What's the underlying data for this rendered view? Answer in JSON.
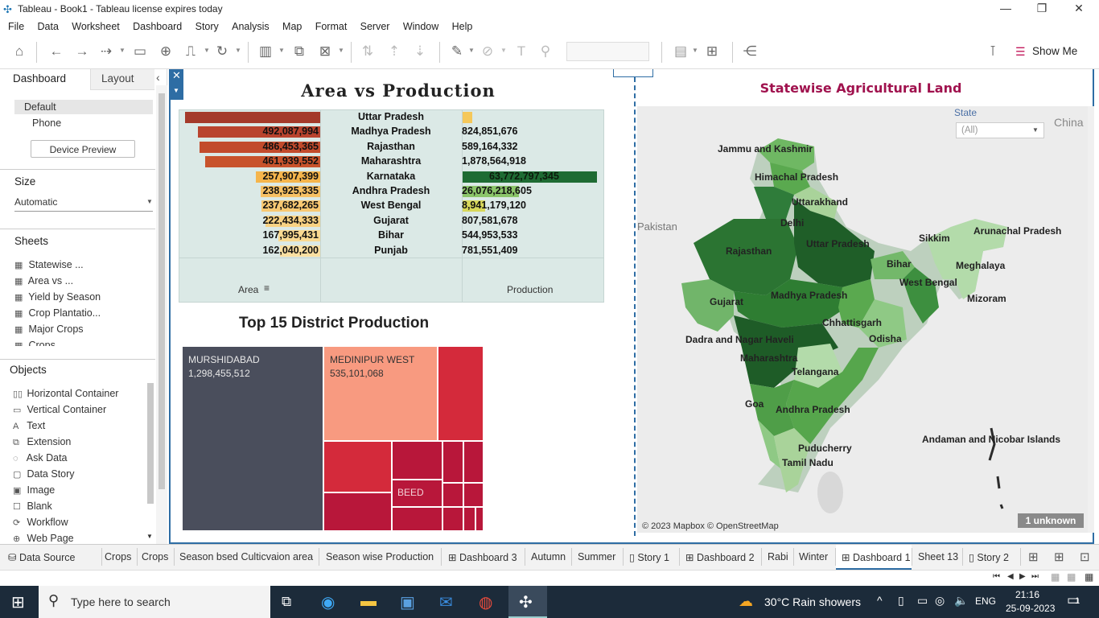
{
  "window": {
    "title": "Tableau - Book1 - Tableau license expires today"
  },
  "menu": [
    "File",
    "Data",
    "Worksheet",
    "Dashboard",
    "Story",
    "Analysis",
    "Map",
    "Format",
    "Server",
    "Window",
    "Help"
  ],
  "toolbar": {
    "show_me": "Show Me"
  },
  "left_panel": {
    "tab_dashboard": "Dashboard",
    "tab_layout": "Layout",
    "devices": [
      "Default",
      "Phone"
    ],
    "device_preview": "Device Preview",
    "size_heading": "Size",
    "size_value": "Automatic",
    "sheets_heading": "Sheets",
    "sheets": [
      "Statewise ...",
      "Area vs ...",
      "Yield by Season",
      "Crop Plantatio...",
      "Major Crops",
      "Crops"
    ],
    "objects_heading": "Objects",
    "objects": [
      "Horizontal Container",
      "Vertical Container",
      "Text",
      "Extension",
      "Ask Data",
      "Data Story",
      "Image",
      "Blank",
      "Workflow",
      "Web Page"
    ]
  },
  "area_vs_production": {
    "title": "Area vs Production",
    "area_header": "Area",
    "production_header": "Production",
    "rows": [
      {
        "state": "Uttar Pradesh",
        "area": "",
        "production": ""
      },
      {
        "state": "Madhya Pradesh",
        "area": "492,087,994",
        "production": "824,851,676"
      },
      {
        "state": "Rajasthan",
        "area": "486,453,365",
        "production": "589,164,332"
      },
      {
        "state": "Maharashtra",
        "area": "461,939,552",
        "production": "1,878,564,918"
      },
      {
        "state": "Karnataka",
        "area": "257,907,399",
        "production": "63,772,797,345"
      },
      {
        "state": "Andhra Pradesh",
        "area": "238,925,335",
        "production": "26,076,218,605"
      },
      {
        "state": "West Bengal",
        "area": "237,682,265",
        "production": "8,941,179,120"
      },
      {
        "state": "Gujarat",
        "area": "222,434,333",
        "production": "807,581,678"
      },
      {
        "state": "Bihar",
        "area": "167,995,431",
        "production": "544,953,533"
      },
      {
        "state": "Punjab",
        "area": "162,040,200",
        "production": "781,551,409"
      }
    ]
  },
  "district": {
    "title": "Top 15 District Production",
    "cells": [
      {
        "name": "MURSHIDABAD",
        "value": "1,298,455,512"
      },
      {
        "name": "MEDINIPUR WEST",
        "value": "535,101,068"
      },
      {
        "name": "BEED",
        "value": ""
      }
    ]
  },
  "map": {
    "title": "Statewise Agricultural Land",
    "filter_label": "State",
    "filter_value": "(All)",
    "labels": [
      "Jammu and Kashmir",
      "Himachal Pradesh",
      "Uttarakhand",
      "Delhi",
      "Pakistan",
      "China",
      "Rajasthan",
      "Uttar Pradesh",
      "Sikkim",
      "Arunachal Pradesh",
      "Meghalaya",
      "Bihar",
      "West Bengal",
      "Mizoram",
      "Gujarat",
      "Madhya Pradesh",
      "Chhattisgarh",
      "Dadra and Nagar Haveli",
      "Odisha",
      "Maharashtra",
      "Telangana",
      "Goa",
      "Andhra Pradesh",
      "Andaman and Nicobar Islands",
      "Puducherry",
      "Tamil Nadu"
    ],
    "attribution": "© 2023 Mapbox © OpenStreetMap",
    "unknown": "1 unknown"
  },
  "sheet_tabs": [
    "Data Source",
    "Crops",
    "Crops",
    "Season bsed Culticvaion area",
    "Season wise Production",
    "Dashboard 3",
    "Autumn",
    "Summer",
    "Story 1",
    "Dashboard 2",
    "Rabi",
    "Winter",
    "Dashboard 1",
    "Sheet 13",
    "Story 2"
  ],
  "taskbar": {
    "search_placeholder": "Type here to search",
    "weather": "30°C  Rain showers",
    "lang": "ENG",
    "time": "21:16",
    "date": "25-09-2023",
    "notif": "1"
  }
}
